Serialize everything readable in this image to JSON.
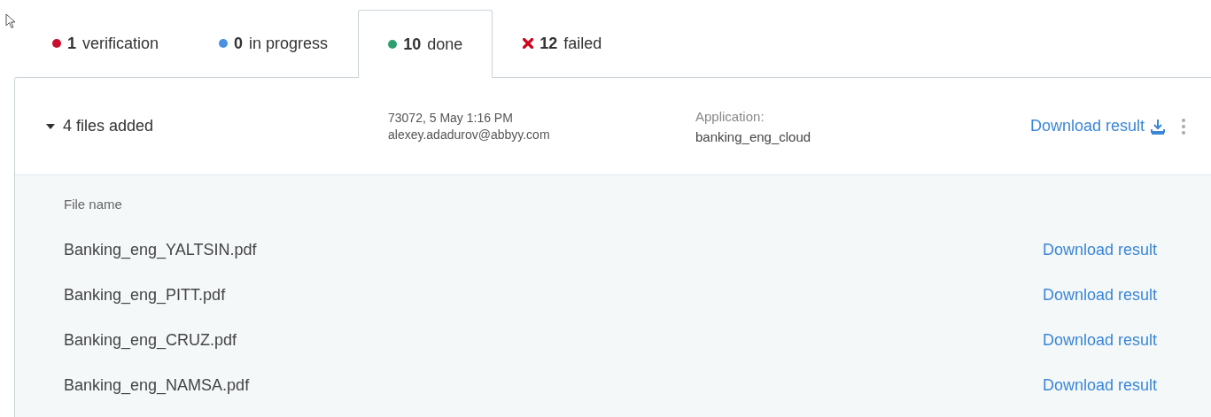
{
  "tabs": [
    {
      "kind": "dot",
      "color": "#c8102e",
      "count": "1",
      "label": "verification",
      "selected": false
    },
    {
      "kind": "dot",
      "color": "#4a90e2",
      "count": "0",
      "label": "in progress",
      "selected": false
    },
    {
      "kind": "dot",
      "color": "#2e9e6e",
      "count": "10",
      "label": "done",
      "selected": true
    },
    {
      "kind": "cross",
      "color": "#d0021b",
      "count": "12",
      "label": "failed",
      "selected": false
    }
  ],
  "batch": {
    "expanded": true,
    "title": "4 files added",
    "meta_line_1": "73072, 5 May 1:16 PM",
    "meta_line_2": "alexey.adadurov@abbyy.com",
    "application_label": "Application:",
    "application_value": "banking_eng_cloud",
    "download": "Download result"
  },
  "files": {
    "column_header": "File name",
    "rows": [
      {
        "name": "Banking_eng_YALTSIN.pdf",
        "download": "Download result"
      },
      {
        "name": "Banking_eng_PITT.pdf",
        "download": "Download result"
      },
      {
        "name": "Banking_eng_CRUZ.pdf",
        "download": "Download result"
      },
      {
        "name": "Banking_eng_NAMSA.pdf",
        "download": "Download result"
      }
    ]
  }
}
